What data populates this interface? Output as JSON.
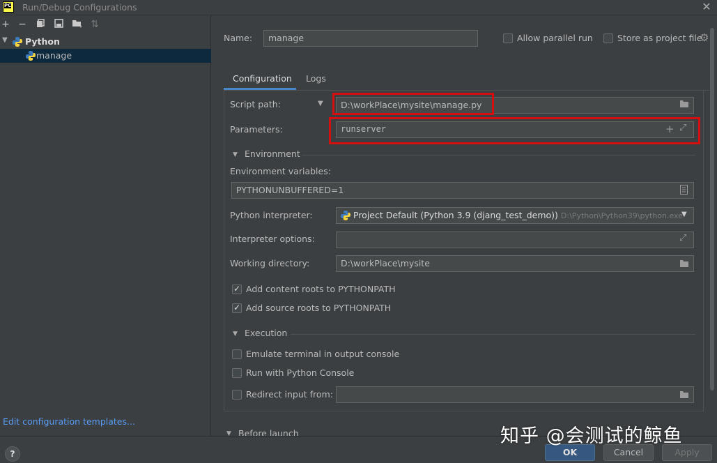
{
  "window": {
    "title": "Run/Debug Configurations",
    "logo_text": "PC"
  },
  "toolbar": {
    "add_icon": "plus-icon",
    "remove_icon": "minus-icon",
    "copy_icon": "copy-icon",
    "save_icon": "save-icon",
    "folder_icon": "new-folder-icon",
    "sort_icon": "sort-icon"
  },
  "tree": {
    "group_label": "Python",
    "item_label": "manage"
  },
  "left_footer": {
    "edit_templates": "Edit configuration templates..."
  },
  "header": {
    "name_label": "Name:",
    "name_value": "manage",
    "allow_parallel": "Allow parallel run",
    "store_as_project": "Store as project file"
  },
  "tabs": [
    {
      "label": "Configuration",
      "active": true
    },
    {
      "label": "Logs",
      "active": false
    }
  ],
  "config": {
    "script_path_label": "Script path:",
    "script_path_value": "D:\\workPlace\\mysite\\manage.py",
    "parameters_label": "Parameters:",
    "parameters_value": "runserver",
    "environment_section": "Environment",
    "env_vars_label": "Environment variables:",
    "env_vars_value": "PYTHONUNBUFFERED=1",
    "interpreter_label": "Python interpreter:",
    "interpreter_value": "Project Default (Python 3.9 (djang_test_demo))",
    "interpreter_path": "D:\\Python\\Python39\\python.exe",
    "interpreter_options_label": "Interpreter options:",
    "interpreter_options_value": "",
    "working_dir_label": "Working directory:",
    "working_dir_value": "D:\\workPlace\\mysite",
    "add_content_roots": "Add content roots to PYTHONPATH",
    "add_content_roots_checked": true,
    "add_source_roots": "Add source roots to PYTHONPATH",
    "add_source_roots_checked": true,
    "execution_section": "Execution",
    "emulate_terminal": "Emulate terminal in output console",
    "emulate_terminal_checked": false,
    "run_python_console": "Run with Python Console",
    "run_python_console_checked": false,
    "redirect_input": "Redirect input from:",
    "redirect_input_checked": false,
    "redirect_input_value": "",
    "before_launch_section": "Before launch"
  },
  "buttons": {
    "ok": "OK",
    "cancel": "Cancel",
    "apply": "Apply",
    "help": "?"
  },
  "watermark": "知乎 @会测试的鲸鱼",
  "colors": {
    "highlight_border": "#d40f0f",
    "selection": "#0d293e",
    "link": "#589df6",
    "primary_button": "#365880"
  }
}
